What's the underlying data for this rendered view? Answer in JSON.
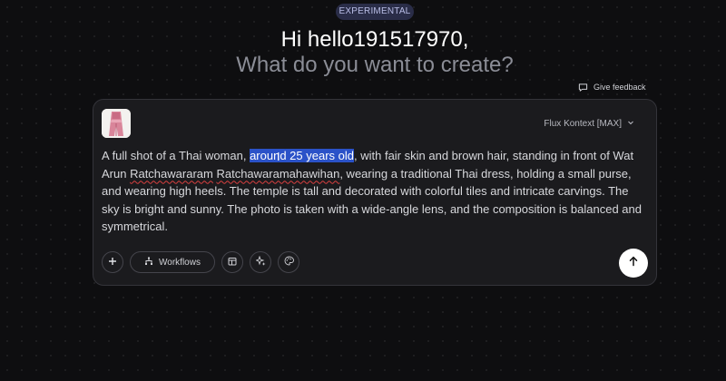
{
  "header": {
    "badge": "EXPERIMENTAL",
    "greeting": "Hi hello191517970,",
    "question": "What do you want to create?"
  },
  "feedback": {
    "label": "Give feedback",
    "icon": "chat-bubble-icon"
  },
  "composer": {
    "model_label": "Flux Kontext [MAX]",
    "attachment_icon": "reference-image-thumbnail",
    "prompt": {
      "p1": "A full shot of a Thai woman, ",
      "highlighted": "around 25 years old",
      "p2": ", with fair skin and brown hair, standing in front of Wat Arun ",
      "misspelled1": "Ratchawararam",
      "p3": " ",
      "misspelled2": "Ratchawaramahawihan",
      "p4": ", wearing a traditional Thai dress, holding a small purse, and wearing high heels. The temple is tall and decorated with colorful tiles and intricate carvings. The sky is bright and sunny. The photo is taken with a wide-angle lens, and the composition is balanced and symmetrical."
    },
    "toolbar": {
      "add_icon": "plus-icon",
      "workflows_label": "Workflows",
      "workflows_icon": "workflow-tree-icon",
      "tool1_icon": "calendar-layout-icon",
      "tool2_icon": "sparkle-magic-icon",
      "tool3_icon": "palette-icon"
    },
    "send_icon": "arrow-up-icon"
  },
  "colors": {
    "background": "#0e0e10",
    "card": "#1b1b1e",
    "selection": "#2b52c8",
    "badge": "#2a2d48",
    "spellcheck": "#d94040"
  }
}
